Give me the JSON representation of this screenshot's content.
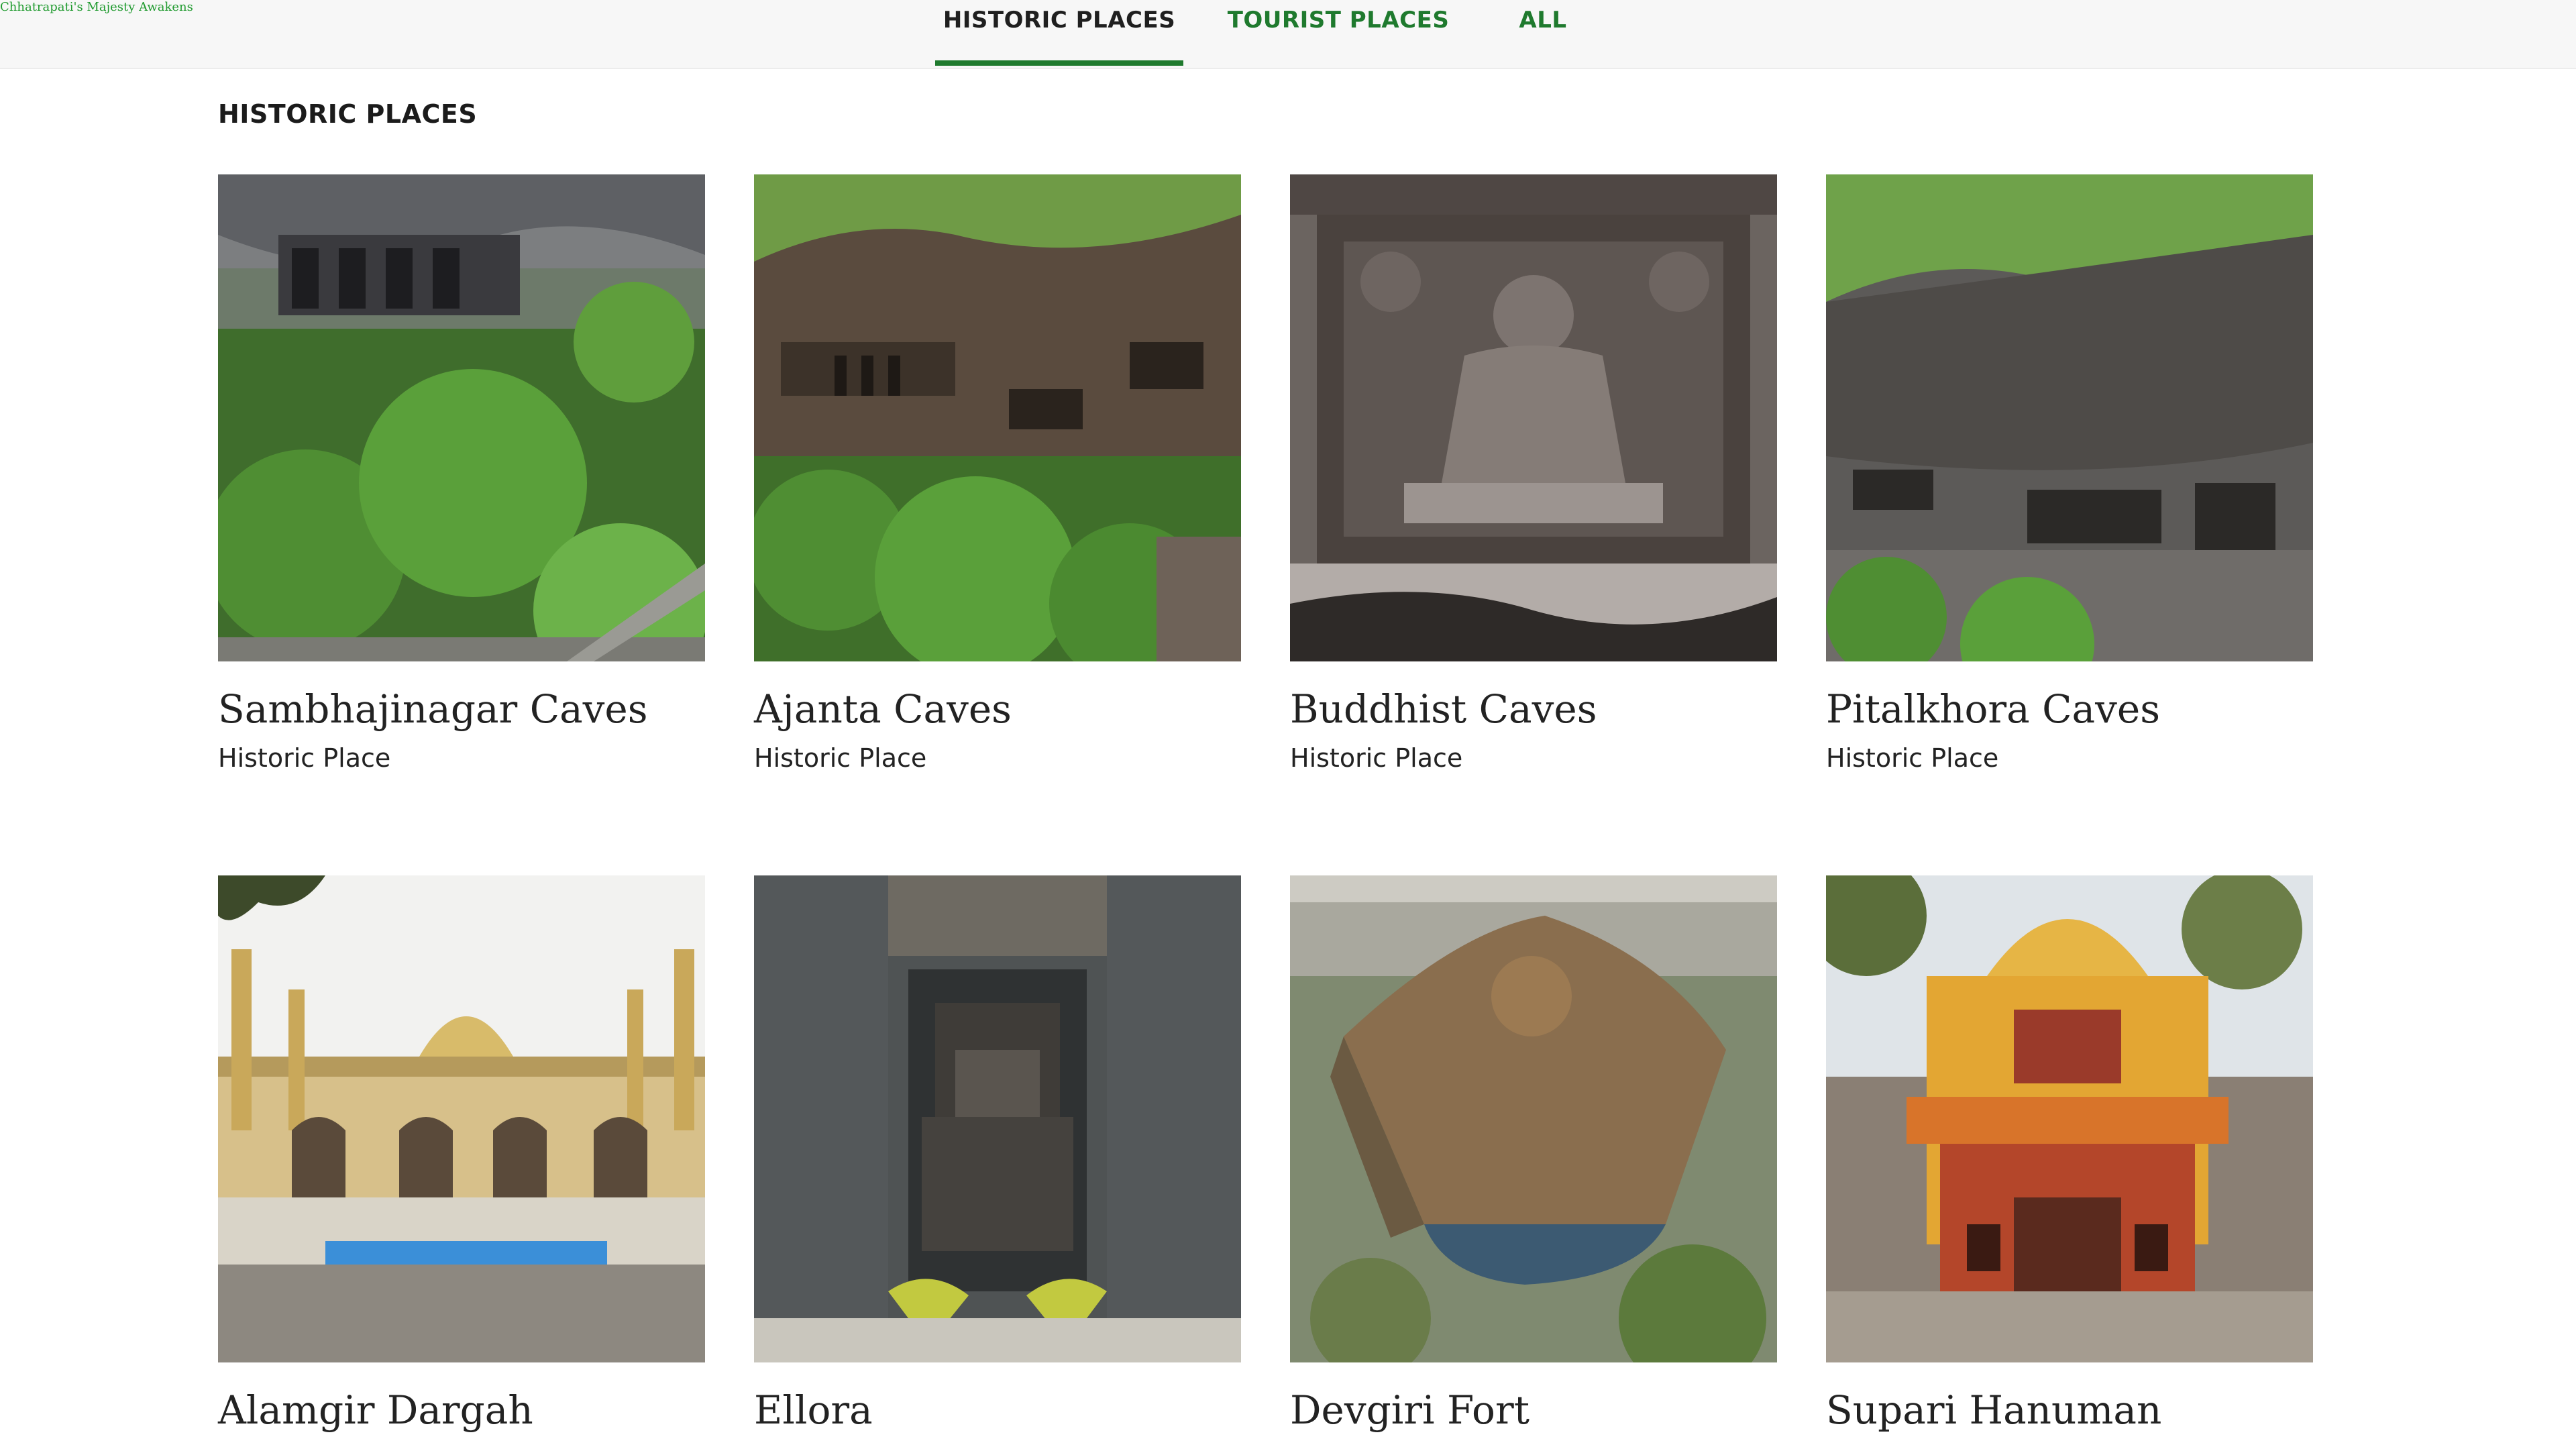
{
  "brand": {
    "text": "Chhatrapati's Majesty Awakens"
  },
  "tabs": [
    {
      "label": "HISTORIC PLACES",
      "active": true
    },
    {
      "label": "TOURIST PLACES",
      "active": false
    },
    {
      "label": "ALL",
      "active": false
    }
  ],
  "section": {
    "title": "HISTORIC PLACES"
  },
  "places": [
    {
      "name": "Sambhajinagar Caves",
      "type": "Historic Place",
      "image": "cave-terrace-with-trees-photo"
    },
    {
      "name": "Ajanta Caves",
      "type": "Historic Place",
      "image": "cliff-cave-facades-photo"
    },
    {
      "name": "Buddhist Caves",
      "type": "Historic Place",
      "image": "buddha-relief-sculpture-photo"
    },
    {
      "name": "Pitalkhora Caves",
      "type": "Historic Place",
      "image": "eroded-rock-cliff-photo"
    },
    {
      "name": "Alamgir Dargah",
      "type": "",
      "image": "mosque-with-dome-and-pool-photo"
    },
    {
      "name": "Ellora",
      "type": "",
      "image": "rock-cut-temple-aerial-photo"
    },
    {
      "name": "Devgiri Fort",
      "type": "",
      "image": "hill-fort-aerial-photo"
    },
    {
      "name": "Supari Hanuman",
      "type": "",
      "image": "ornate-temple-gate-photo"
    }
  ],
  "colors": {
    "accent": "#1f7a2e",
    "brand_text": "#1f9a2e",
    "topbar_bg": "#f7f7f7"
  }
}
